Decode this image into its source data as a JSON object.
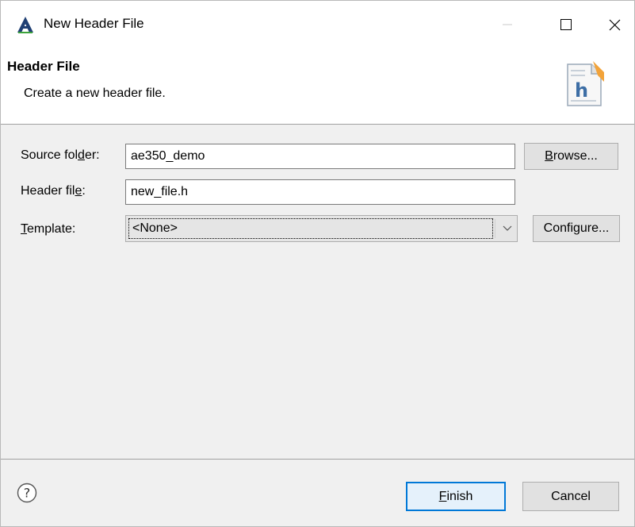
{
  "window": {
    "title": "New Header File",
    "app_icon": "eclipse-app-icon",
    "controls": {
      "minimize": "minimize-icon",
      "maximize": "maximize-icon",
      "close": "close-icon"
    }
  },
  "banner": {
    "title": "Header File",
    "description": "Create a new header file.",
    "icon": "header-file-h-icon"
  },
  "form": {
    "source_folder": {
      "label_pre": "Source fol",
      "label_mnemonic": "d",
      "label_post": "er:",
      "value": "ae350_demo",
      "button_label_mnemonic": "B",
      "button_label_post": "rowse..."
    },
    "header_file": {
      "label_pre": "Header fil",
      "label_mnemonic": "e",
      "label_post": ":",
      "value": "new_file.h"
    },
    "template": {
      "label_mnemonic": "T",
      "label_post": "emplate:",
      "selected": "<None>",
      "button_label": "Configure..."
    }
  },
  "footer": {
    "help_icon": "help-icon",
    "finish_mnemonic": "F",
    "finish_post": "inish",
    "cancel_label": "Cancel"
  },
  "colors": {
    "accent": "#0078d7",
    "dialog_bg": "#f0f0f0",
    "button_bg": "#e1e1e1"
  }
}
